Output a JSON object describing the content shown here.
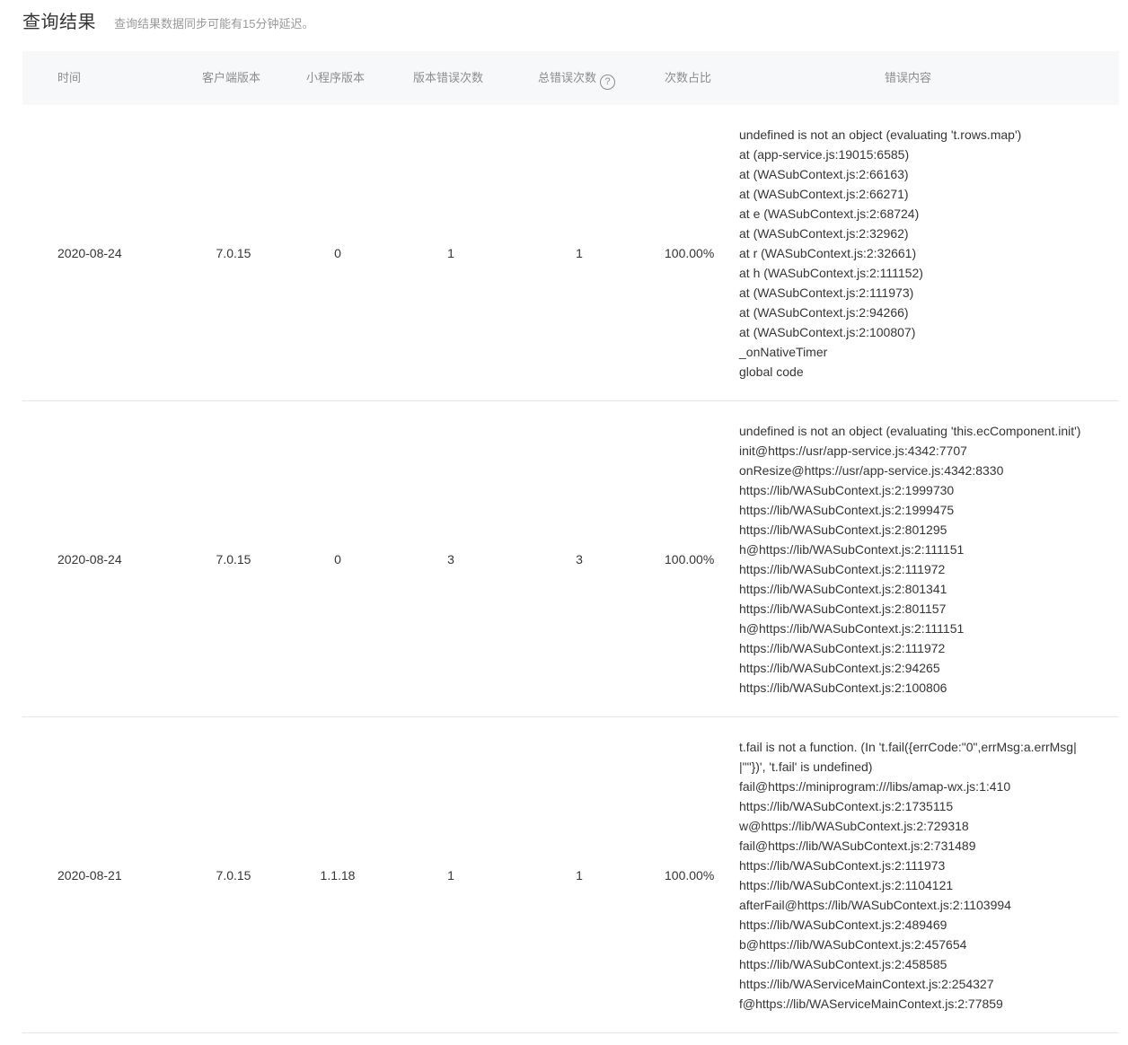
{
  "header": {
    "title": "查询结果",
    "note": "查询结果数据同步可能有15分钟延迟。"
  },
  "table": {
    "columns": {
      "time": "时间",
      "client_version": "客户端版本",
      "app_version": "小程序版本",
      "version_error_count": "版本错误次数",
      "total_error_count": "总错误次数",
      "help_icon": "?",
      "ratio": "次数占比",
      "message": "错误内容"
    },
    "rows": [
      {
        "time": "2020-08-24",
        "client_version": "7.0.15",
        "app_version": "0",
        "version_error_count": "1",
        "total_error_count": "1",
        "ratio": "100.00%",
        "message": [
          "undefined is not an object (evaluating 't.rows.map')",
          "at (app-service.js:19015:6585)",
          "at (WASubContext.js:2:66163)",
          "at (WASubContext.js:2:66271)",
          "at e (WASubContext.js:2:68724)",
          "at (WASubContext.js:2:32962)",
          "at r (WASubContext.js:2:32661)",
          "at h (WASubContext.js:2:111152)",
          "at (WASubContext.js:2:111973)",
          "at (WASubContext.js:2:94266)",
          "at (WASubContext.js:2:100807)",
          "_onNativeTimer",
          "global code"
        ]
      },
      {
        "time": "2020-08-24",
        "client_version": "7.0.15",
        "app_version": "0",
        "version_error_count": "3",
        "total_error_count": "3",
        "ratio": "100.00%",
        "message": [
          "undefined is not an object (evaluating 'this.ecComponent.init')",
          "init@https://usr/app-service.js:4342:7707",
          "onResize@https://usr/app-service.js:4342:8330",
          "https://lib/WASubContext.js:2:1999730",
          "https://lib/WASubContext.js:2:1999475",
          "https://lib/WASubContext.js:2:801295",
          "h@https://lib/WASubContext.js:2:111151",
          "https://lib/WASubContext.js:2:111972",
          "https://lib/WASubContext.js:2:801341",
          "https://lib/WASubContext.js:2:801157",
          "h@https://lib/WASubContext.js:2:111151",
          "https://lib/WASubContext.js:2:111972",
          "https://lib/WASubContext.js:2:94265",
          "https://lib/WASubContext.js:2:100806"
        ]
      },
      {
        "time": "2020-08-21",
        "client_version": "7.0.15",
        "app_version": "1.1.18",
        "version_error_count": "1",
        "total_error_count": "1",
        "ratio": "100.00%",
        "message": [
          "t.fail is not a function. (In 't.fail({errCode:\"0\",errMsg:a.errMsg||\"\"})', 't.fail' is undefined)",
          "fail@https://miniprogram:///libs/amap-wx.js:1:410",
          "https://lib/WASubContext.js:2:1735115",
          "w@https://lib/WASubContext.js:2:729318",
          "fail@https://lib/WASubContext.js:2:731489",
          "https://lib/WASubContext.js:2:111973",
          "https://lib/WASubContext.js:2:1104121",
          "afterFail@https://lib/WASubContext.js:2:1103994",
          "https://lib/WASubContext.js:2:489469",
          "b@https://lib/WASubContext.js:2:457654",
          "https://lib/WASubContext.js:2:458585",
          "https://lib/WAServiceMainContext.js:2:254327",
          "f@https://lib/WAServiceMainContext.js:2:77859"
        ]
      }
    ]
  }
}
